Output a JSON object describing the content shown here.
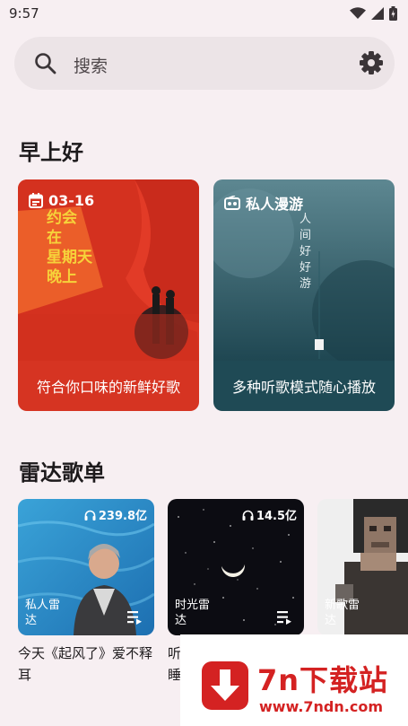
{
  "status_bar": {
    "time": "9:57"
  },
  "search": {
    "placeholder": "搜索"
  },
  "greeting": {
    "title": "早上好"
  },
  "feature_cards": [
    {
      "tag": "03-16",
      "caption": "符合你口味的新鲜好歌",
      "color": "#d83a28",
      "art_text": [
        "约会",
        "在",
        "星期天",
        "晚上"
      ]
    },
    {
      "tag": "私人漫游",
      "caption": "多种听歌模式随心播放",
      "color": "#1f4a55",
      "art_text": [
        "人间",
        "好好",
        "游"
      ]
    }
  ],
  "radar": {
    "title": "雷达歌单",
    "playlists": [
      {
        "count": "239.8亿",
        "label": "私人雷达",
        "title": "今天《起风了》爱不释耳"
      },
      {
        "count": "14.5亿",
        "label": "时光雷达",
        "title": "听睡"
      },
      {
        "count": "",
        "label": "新歌雷达",
        "title": ""
      }
    ]
  },
  "watermark": {
    "name": "7n下载站",
    "url": "www.7ndn.com"
  }
}
